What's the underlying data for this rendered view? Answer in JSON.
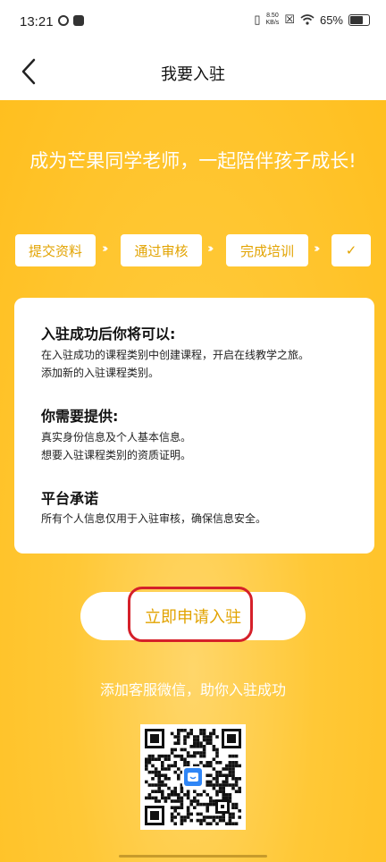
{
  "status_bar": {
    "time": "13:21",
    "net_speed_value": "8.50",
    "net_speed_unit": "KB/s",
    "battery": "65%"
  },
  "nav": {
    "title": "我要入驻"
  },
  "slogan": "成为芒果同学老师，一起陪伴孩子成长!",
  "steps": [
    "提交资料",
    "通过审核",
    "完成培训",
    "✓"
  ],
  "card": {
    "sections": [
      {
        "title": "入驻成功后你将可以:",
        "lines": [
          "在入驻成功的课程类别中创建课程，开启在线教学之旅。",
          "添加新的入驻课程类别。"
        ]
      },
      {
        "title": "你需要提供:",
        "lines": [
          "真实身份信息及个人基本信息。",
          "想要入驻课程类别的资质证明。"
        ]
      },
      {
        "title": "平台承诺",
        "lines": [
          "所有个人信息仅用于入驻审核，确保信息安全。"
        ]
      }
    ]
  },
  "apply_button": "立即申请入驻",
  "contact_text": "添加客服微信，助你入驻成功",
  "colors": {
    "accent": "#E2A300",
    "background": "#FFC428",
    "highlight": "#D5202A"
  }
}
